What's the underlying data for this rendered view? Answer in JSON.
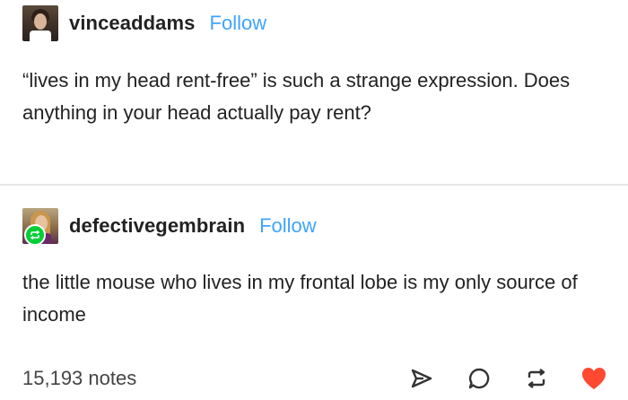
{
  "posts": [
    {
      "username": "vinceaddams",
      "follow_label": "Follow",
      "text": "“lives in my head rent-free” is such a strange expression. Does anything in your head actually pay rent?"
    },
    {
      "username": "defectivegembrain",
      "follow_label": "Follow",
      "text": "the little mouse who lives in my frontal lobe is my only source of income"
    }
  ],
  "footer": {
    "notes": "15,193 notes",
    "icons": [
      "share-icon",
      "reply-icon",
      "reblog-icon",
      "like-icon"
    ]
  },
  "colors": {
    "follow": "#3fa4ff",
    "reblog_badge": "#00cf35",
    "like": "#ff4930",
    "text": "#222222"
  }
}
